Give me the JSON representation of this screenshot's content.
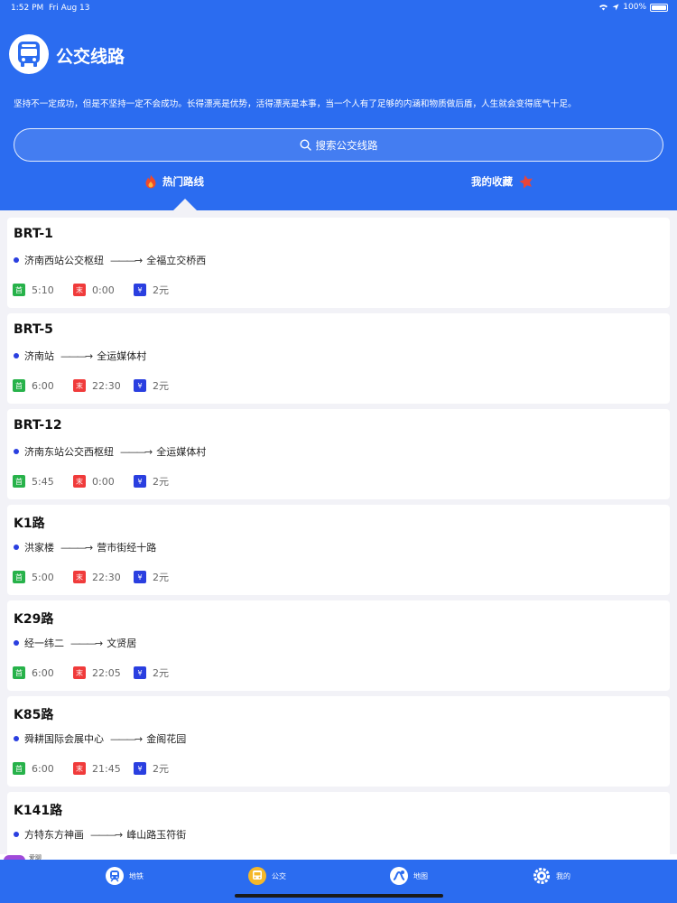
{
  "status_bar": {
    "time": "1:52 PM",
    "date": "Fri Aug 13",
    "battery": "100%"
  },
  "header": {
    "title": "公交线路",
    "motto": "坚持不一定成功，但是不坚持一定不会成功。长得漂亮是优势，活得漂亮是本事，当一个人有了足够的内涵和物质做后盾，人生就会变得底气十足。",
    "search_placeholder": "搜索公交线路",
    "tabs": [
      {
        "label": "热门路线",
        "icon": "fire-icon",
        "active": true
      },
      {
        "label": "我的收藏",
        "icon": "star-icon",
        "active": false
      }
    ]
  },
  "routes": [
    {
      "name": "BRT-1",
      "from": "济南西站公交枢纽",
      "to": "全福立交桥西",
      "first": "5:10",
      "last": "0:00",
      "fare": "2元"
    },
    {
      "name": "BRT-5",
      "from": "济南站",
      "to": "全运媒体村",
      "first": "6:00",
      "last": "22:30",
      "fare": "2元"
    },
    {
      "name": "BRT-12",
      "from": "济南东站公交西枢纽",
      "to": "全运媒体村",
      "first": "5:45",
      "last": "0:00",
      "fare": "2元"
    },
    {
      "name": "K1路",
      "from": "洪家楼",
      "to": "营市街经十路",
      "first": "5:00",
      "last": "22:30",
      "fare": "2元"
    },
    {
      "name": "K29路",
      "from": "经一纬二",
      "to": "文贤居",
      "first": "6:00",
      "last": "22:05",
      "fare": "2元"
    },
    {
      "name": "K85路",
      "from": "舜耕国际会展中心",
      "to": "金阁花园",
      "first": "6:00",
      "last": "21:45",
      "fare": "2元"
    },
    {
      "name": "K141路",
      "from": "方特东方神画",
      "to": "峰山路玉符街",
      "first": "",
      "last": "",
      "fare": ""
    }
  ],
  "badges": {
    "first": "首",
    "last": "末",
    "fare": "¥"
  },
  "arrow": "———→",
  "ad": {
    "text": "爱聊"
  },
  "tabbar": [
    {
      "label": "地铁",
      "icon": "subway-icon"
    },
    {
      "label": "公交",
      "icon": "bus-icon",
      "active": true
    },
    {
      "label": "地图",
      "icon": "map-icon"
    },
    {
      "label": "我的",
      "icon": "settings-icon"
    }
  ],
  "colors": {
    "primary": "#2b6cf0",
    "first_badge": "#27b24a",
    "last_badge": "#f03b3b",
    "fare_badge": "#2a3fe0",
    "active_tab_icon": "#f5b829"
  }
}
